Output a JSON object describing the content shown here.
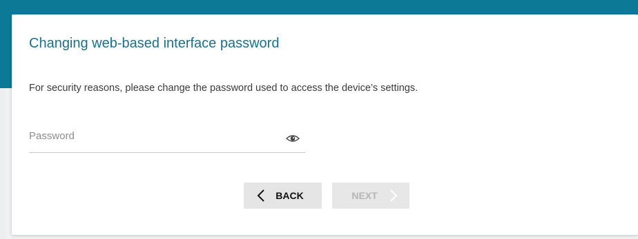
{
  "dialog": {
    "title": "Changing web-based interface password",
    "description": "For security reasons, please change the password used to access the device’s settings.",
    "password": {
      "placeholder": "Password",
      "value": "",
      "toggle_icon": "eye-icon"
    },
    "buttons": {
      "back_label": "BACK",
      "next_label": "NEXT",
      "next_enabled": false
    }
  },
  "colors": {
    "accent": "#0c7a96",
    "title": "#1c6f8a",
    "button_bg": "#e5e5e5",
    "disabled_text": "#b5b5b5"
  }
}
